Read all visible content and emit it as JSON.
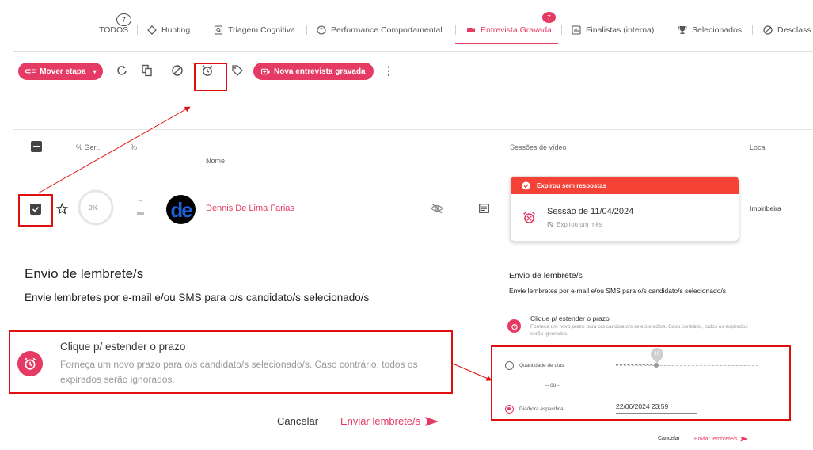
{
  "tabs": {
    "items": [
      {
        "label": "TODOS",
        "badge": "7",
        "icon": "none"
      },
      {
        "label": "Hunting",
        "icon": "target-icon"
      },
      {
        "label": "Triagem Cognitiva",
        "icon": "search-doc-icon"
      },
      {
        "label": "Performance Comportamental",
        "icon": "face-icon"
      },
      {
        "label": "Entrevista Gravada",
        "badge": "7",
        "icon": "video-icon",
        "active": true
      },
      {
        "label": "Finalistas (interna)",
        "icon": "chart-icon"
      },
      {
        "label": "Selecionados",
        "icon": "trophy-icon"
      },
      {
        "label": "Desclass",
        "icon": "block-icon"
      }
    ]
  },
  "toolbar": {
    "move_stage_label": "Mover etapa",
    "new_interview_label": "Nova entrevista gravada"
  },
  "table": {
    "headers": {
      "score_general": "% Ger...",
      "score": "%",
      "name": "Nome",
      "video_sessions": "Sessões de vídeo",
      "location": "Local"
    },
    "row": {
      "progress": "0%",
      "dash": "--",
      "name": "Dennis De Lima Farias",
      "location": "Imbiribeira",
      "avatar_text": "de"
    },
    "video_card": {
      "status": "Expirou sem respostas",
      "session": "Sessão de 11/04/2024",
      "expired": "Expirou um mês"
    }
  },
  "dialog": {
    "title": "Envio de lembrete/s",
    "subtitle": "Envie lembretes por e-mail e/ou SMS para o/s candidato/s selecionado/s",
    "option_title": "Clique p/ estender o prazo",
    "option_desc": "Forneça um novo prazo para o/s candidato/s selecionado/s. Caso contrário, todos os expirados serão ignorados.",
    "cancel_label": "Cancelar",
    "send_label": "Enviar lembrete/s",
    "days_label": "Quantidade de dias",
    "days_value": "10",
    "or_label": "-- ou --",
    "datetime_label": "Dia/hora específica",
    "datetime_value": "22/06/2024 23:59"
  },
  "colors": {
    "accent": "#e53a63",
    "highlight": "#e01010",
    "expired": "#f44336"
  }
}
